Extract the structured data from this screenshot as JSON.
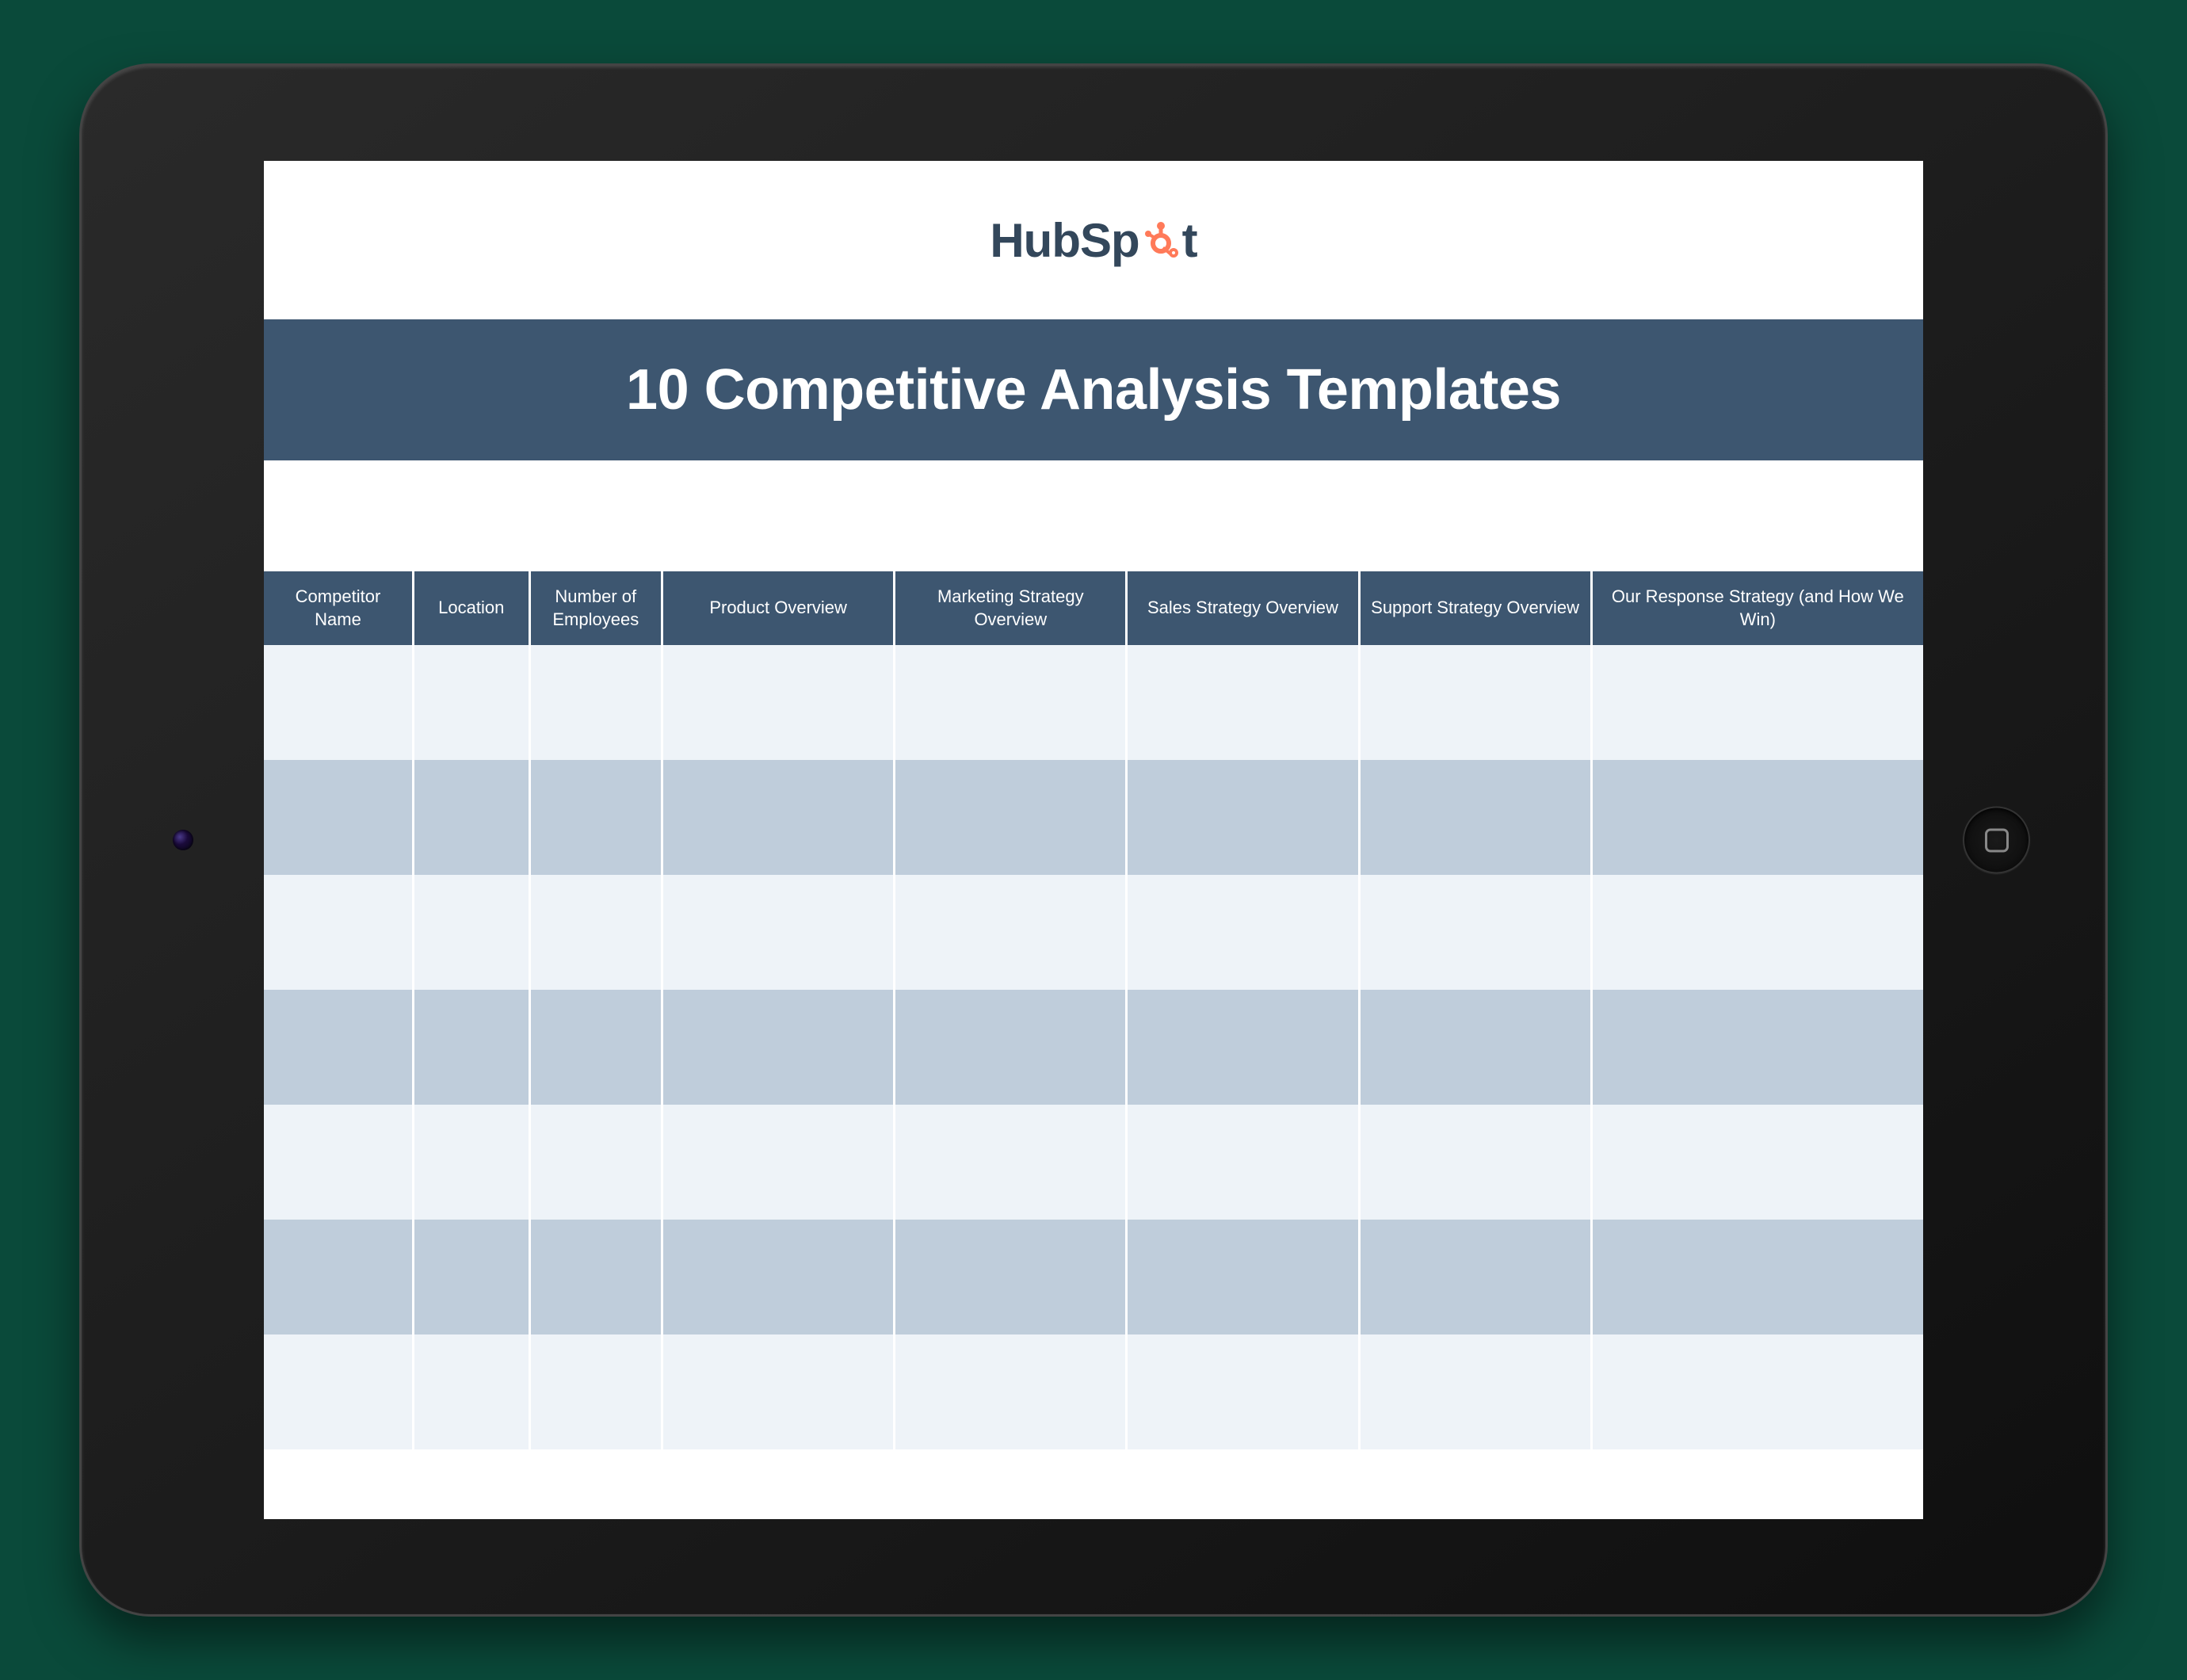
{
  "brand": {
    "name_part1": "HubSp",
    "name_part2": "t",
    "accent_color": "#ff7a59"
  },
  "header": {
    "title": "10 Competitive Analysis Templates"
  },
  "table": {
    "columns": [
      "Competitor Name",
      "Location",
      "Number of Employees",
      "Product Overview",
      "Marketing Strategy Overview",
      "Sales Strategy Overview",
      "Support Strategy Overview",
      "Our Response Strategy (and How We Win)"
    ],
    "row_count": 7
  }
}
